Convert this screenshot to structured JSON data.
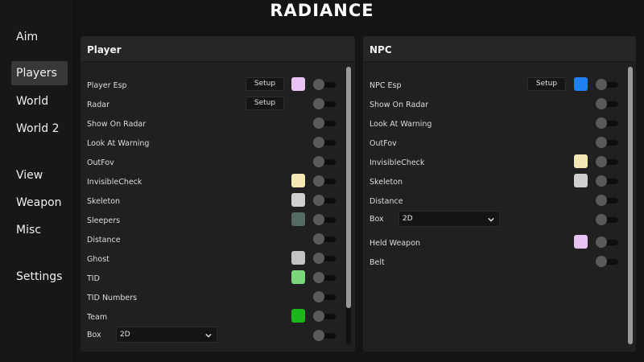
{
  "brand": "RADIANCE",
  "nav": {
    "aim": "Aim",
    "players": "Players",
    "world": "World",
    "world2": "World 2",
    "view": "View",
    "weapon": "Weapon",
    "misc": "Misc",
    "settings": "Settings"
  },
  "player_panel": {
    "title": "Player",
    "rows": {
      "esp": {
        "label": "Player Esp",
        "button": "Setup",
        "color": "#e6c3f2",
        "enabled": false
      },
      "radar": {
        "label": "Radar",
        "button": "Setup",
        "enabled": false
      },
      "show_on_radar": {
        "label": "Show On Radar",
        "enabled": false
      },
      "look_at_warning": {
        "label": "Look At Warning",
        "enabled": false
      },
      "outfov": {
        "label": "OutFov",
        "enabled": false
      },
      "invisible_check": {
        "label": "InvisibleCheck",
        "color": "#f3e8b4",
        "enabled": false
      },
      "skeleton": {
        "label": "Skeleton",
        "color": "#cfcfcf",
        "enabled": false
      },
      "sleepers": {
        "label": "Sleepers",
        "color": "#566b63",
        "enabled": false
      },
      "distance": {
        "label": "Distance",
        "enabled": false
      },
      "ghost": {
        "label": "Ghost",
        "color": "#c3c3c3",
        "enabled": false
      },
      "tid": {
        "label": "TID",
        "color": "#7bd67b",
        "enabled": false
      },
      "tid_numbers": {
        "label": "TID Numbers",
        "enabled": false
      },
      "team": {
        "label": "Team",
        "color": "#19b719",
        "enabled": false
      },
      "box": {
        "label": "Box",
        "value": "2D",
        "enabled": false
      }
    }
  },
  "npc_panel": {
    "title": "NPC",
    "rows": {
      "esp": {
        "label": "NPC Esp",
        "button": "Setup",
        "color": "#1f80f5",
        "enabled": false
      },
      "show_on_radar": {
        "label": "Show On Radar",
        "enabled": false
      },
      "look_at_warning": {
        "label": "Look At Warning",
        "enabled": false
      },
      "outfov": {
        "label": "OutFov",
        "enabled": false
      },
      "invisible_check": {
        "label": "InvisibleCheck",
        "color": "#f3e8b4",
        "enabled": false
      },
      "skeleton": {
        "label": "Skeleton",
        "color": "#cfcfcf",
        "enabled": false
      },
      "distance": {
        "label": "Distance",
        "enabled": false
      },
      "box": {
        "label": "Box",
        "value": "2D",
        "enabled": false
      },
      "held_weapon": {
        "label": "Held Weapon",
        "color": "#e6c3f2",
        "enabled": false
      },
      "belt": {
        "label": "Belt",
        "enabled": false
      }
    }
  },
  "colors": {
    "sidebar_bg": "#171717",
    "panel_bg": "#202020",
    "active_nav": "#383838"
  }
}
